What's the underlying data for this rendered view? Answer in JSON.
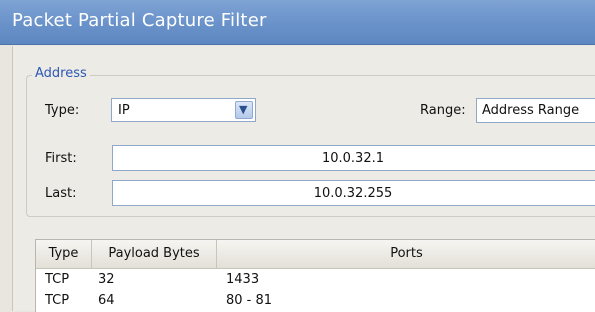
{
  "window": {
    "title": "Packet Partial Capture Filter"
  },
  "address": {
    "group_label": "Address",
    "type_label": "Type:",
    "type_value": "IP",
    "range_label": "Range:",
    "range_value": "Address Range",
    "first_label": "First:",
    "first_value": "10.0.32.1",
    "last_label": "Last:",
    "last_value": "10.0.32.255"
  },
  "table": {
    "headers": [
      "Type",
      "Payload Bytes",
      "Ports"
    ],
    "rows": [
      [
        "TCP",
        "32",
        "1433"
      ],
      [
        "TCP",
        "64",
        "80 - 81"
      ]
    ]
  }
}
